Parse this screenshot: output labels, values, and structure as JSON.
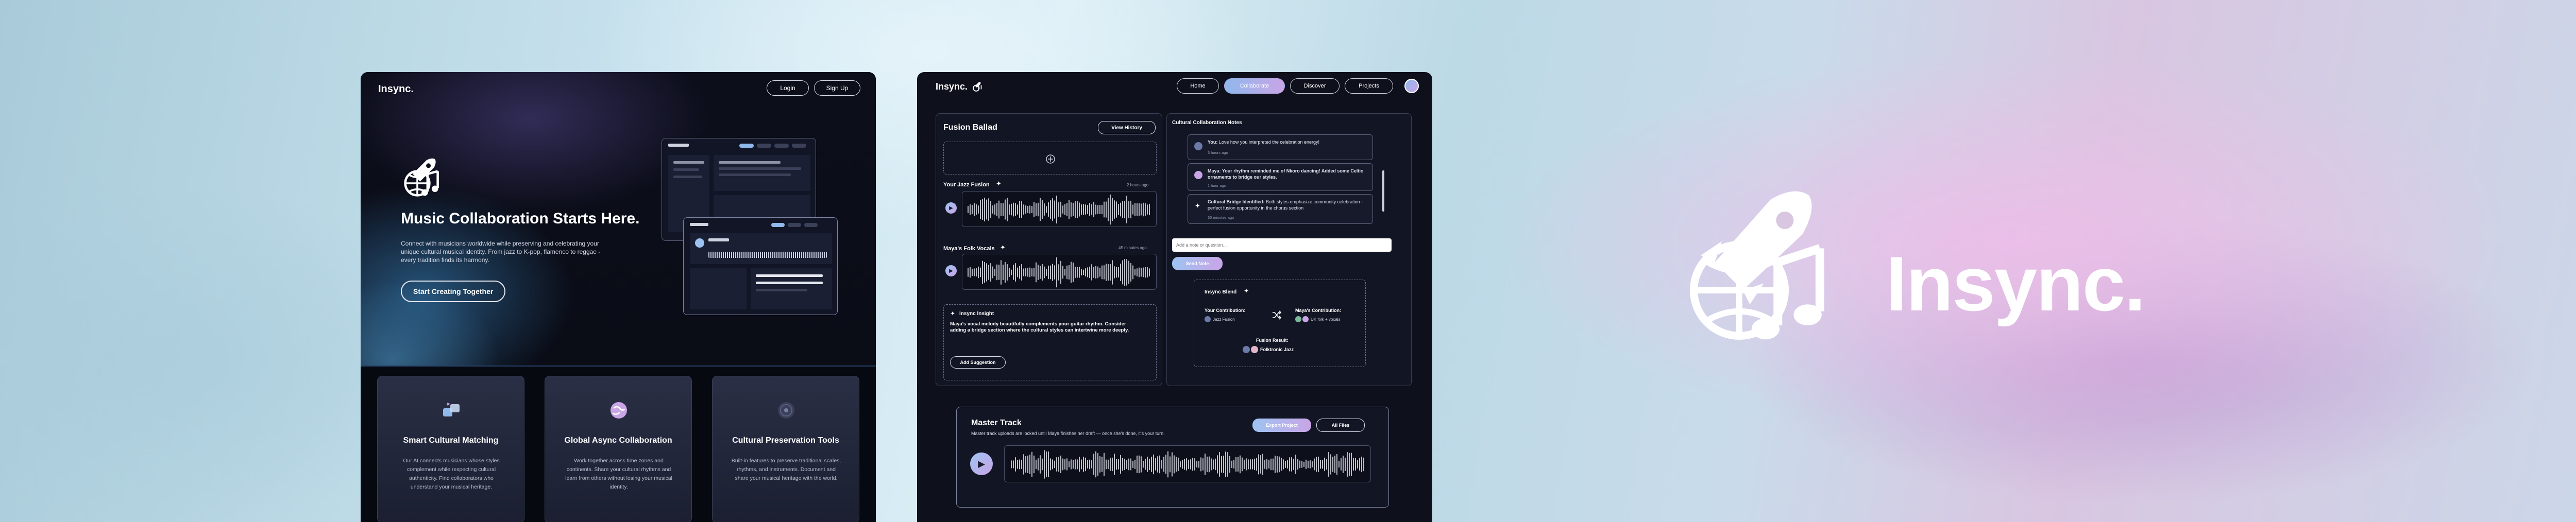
{
  "panel1": {
    "brand": "Insync.",
    "login": "Login",
    "signup": "Sign Up",
    "hero_title": "Music Collaboration Starts Here.",
    "hero_sub": "Connect with musicians worldwide while preserving and celebrating your unique cultural musical identity. From jazz to K-pop, flamenco to reggae - every tradition finds its harmony.",
    "cta": "Start Creating Together",
    "cards": [
      {
        "title": "Smart Cultural Matching",
        "desc": "Our AI connects musicians whose styles complement while respecting cultural authenticity. Find collaborators who understand your musical heritage."
      },
      {
        "title": "Global Async Collaboration",
        "desc": "Work together across time zones and continents. Share your cultural rhythms and learn from others without losing your musical identity."
      },
      {
        "title": "Cultural Preservation Tools",
        "desc": "Built-in features to preserve traditional scales, rhythms, and instruments. Document and share your musical heritage with the world."
      }
    ]
  },
  "panel2": {
    "brand": "Insync.",
    "nav": [
      "Home",
      "Collaborate",
      "Discover",
      "Projects"
    ],
    "project_title": "Fusion Ballad",
    "view_history": "View History",
    "track1": {
      "label": "Your Jazz Fusion",
      "time": "2 hours ago"
    },
    "track2": {
      "label": "Maya's Folk Vocals",
      "time": "45 minutes ago"
    },
    "insight_title": "Insync Insight",
    "insight_text": "Maya's vocal melody beautifully complements your guitar rhythm. Consider adding a bridge section where the cultural styles can intertwine more deeply.",
    "add_suggestion": "Add Suggestion",
    "notes_title": "Cultural Collaboration Notes",
    "notes": [
      {
        "author": "You:",
        "text": "Love how you interpreted the celebration energy!",
        "time": "3 hours ago"
      },
      {
        "author": "Maya:",
        "text": "Your rhythm reminded me of Nkoro dancing! Added some Celtic ornaments to bridge our styles.",
        "time": "1 hour ago"
      },
      {
        "author": "Cultural Bridge Identified:",
        "text": "Both styles emphasize community celebration - perfect fusion opportunity in the chorus section",
        "time": "30 minutes ago"
      }
    ],
    "input_placeholder": "Add a note or question...",
    "send_note": "Send Note",
    "blend": {
      "title": "Insync Blend",
      "your_label": "Your Contribution:",
      "your_value": "Jazz Fusion",
      "maya_label": "Maya's Contribution:",
      "maya_value": "UK folk + vocals",
      "result_label": "Fusion Result:",
      "result_value": "Folktronic Jazz"
    },
    "master": {
      "title": "Master Track",
      "subtitle": "Master track uploads are locked until Maya finishes her draft — once she's done, it's your turn.",
      "export": "Export Project",
      "all_files": "All Files"
    }
  },
  "brand_large": "Insync."
}
